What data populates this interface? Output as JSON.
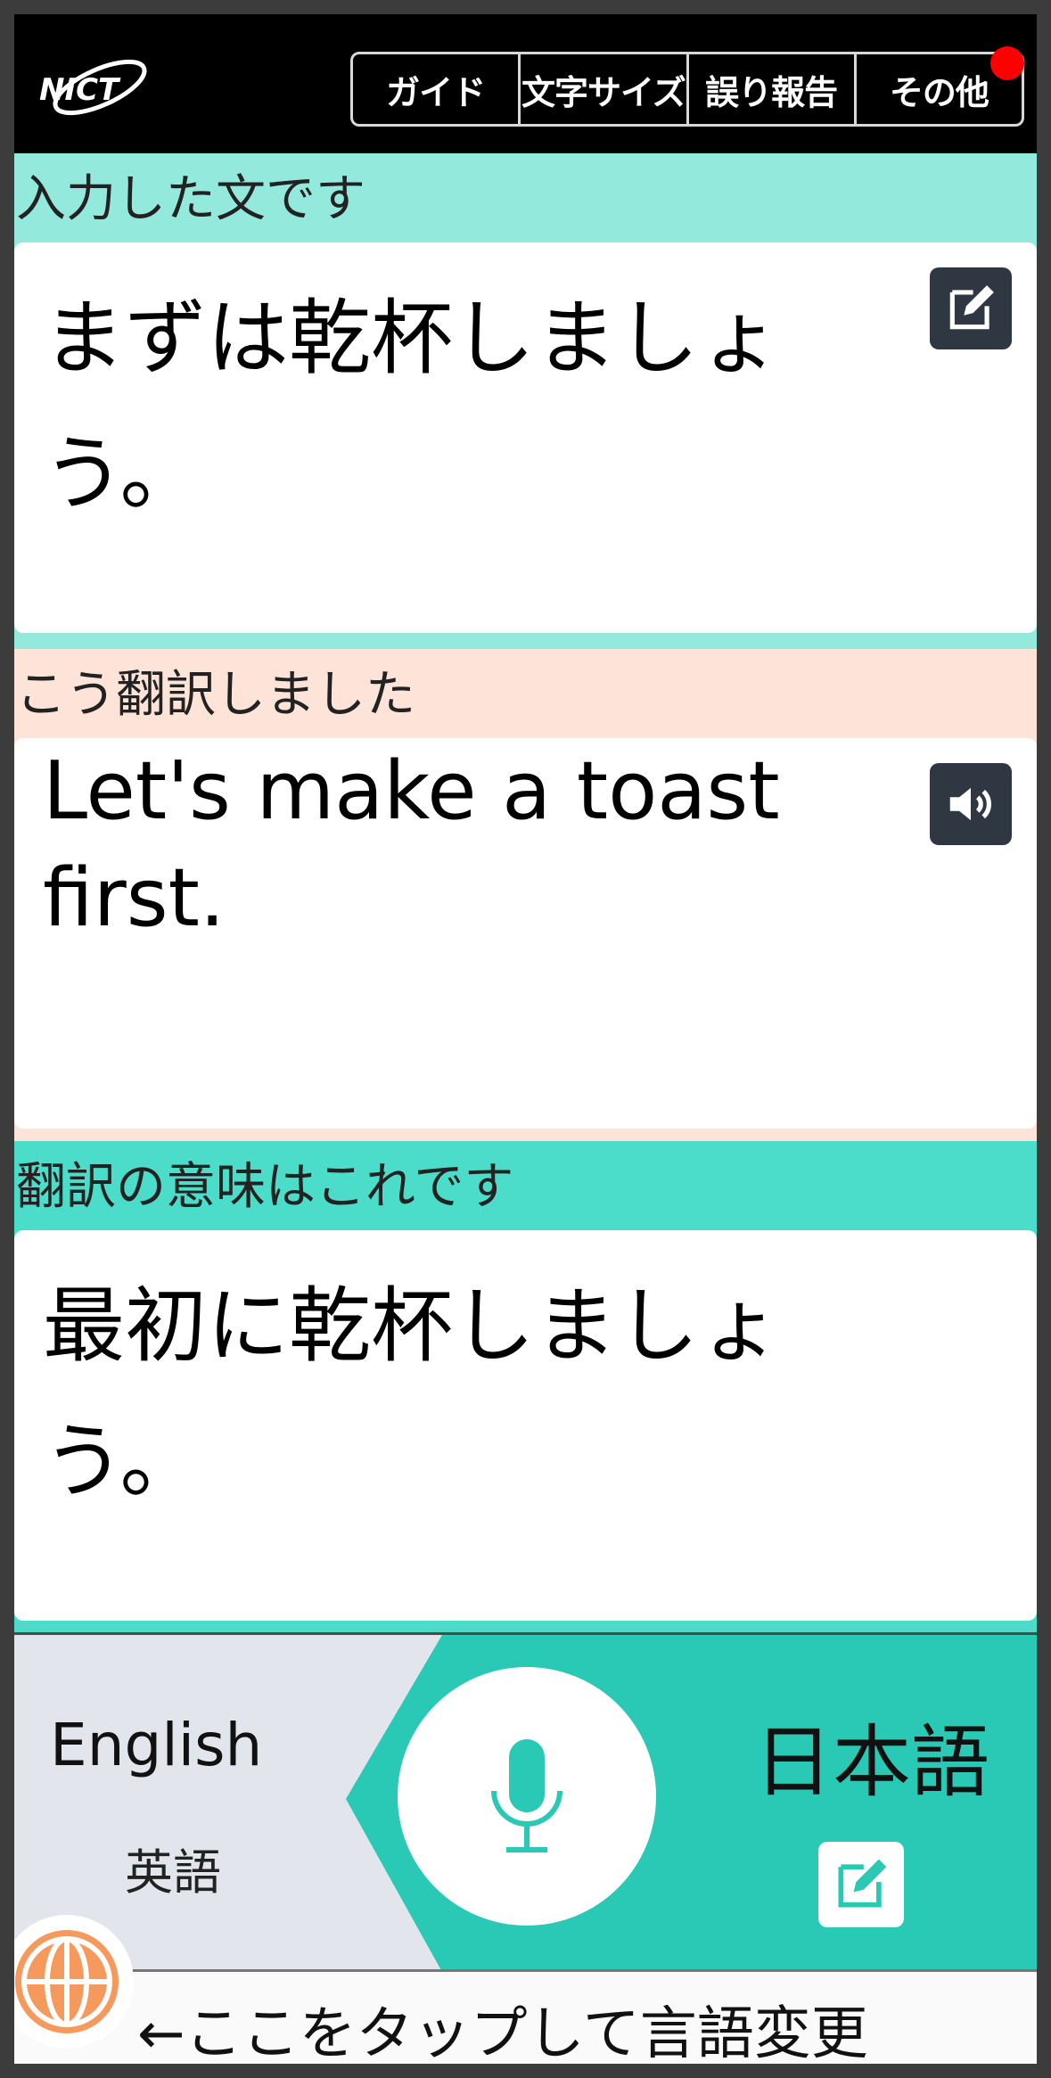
{
  "header": {
    "logo_text": "NICT",
    "menu": [
      "ガイド",
      "文字サイズ",
      "誤り報告",
      "その他"
    ],
    "has_notification": true
  },
  "input_section": {
    "label": "入力した文です",
    "text": "まずは乾杯しましょう。",
    "edit_icon": "edit-icon"
  },
  "translation_section": {
    "label": "こう翻訳しました",
    "text": "Let's make a toast first.",
    "speaker_icon": "speaker-icon"
  },
  "backtranslation_section": {
    "label": "翻訳の意味はこれです",
    "text": "最初に乾杯しましょう。"
  },
  "language_bar": {
    "source_language": "English",
    "source_language_sub": "英語",
    "target_language": "日本語",
    "mic_icon": "microphone-icon"
  },
  "footer": {
    "hint": "←ここをタップして言語変更",
    "globe_icon": "globe-icon"
  },
  "colors": {
    "header": "#000000",
    "input_band": "#93e9dc",
    "translation_band": "#fde3d8",
    "backtranslation_band": "#4bddca",
    "target_lang_bg": "#2ac9b6",
    "source_lang_bg": "#e2e6ec",
    "accent_globe": "#f59a5c",
    "icon_button": "#2f3742",
    "notification": "#ff0000"
  }
}
